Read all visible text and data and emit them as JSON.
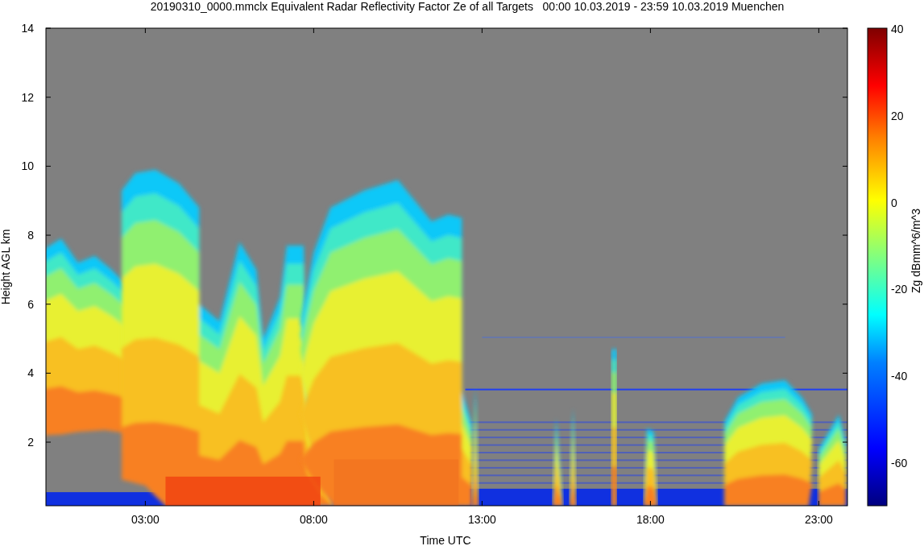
{
  "title": "20190310_0000.mmclx Equivalent Radar Reflectivity Factor Ze of all Targets   00:00 10.03.2019 - 23:59 10.03.2019 Muenchen",
  "y_axis": {
    "label": "Height AGL km",
    "ticks": [
      "14",
      "12",
      "10",
      "8",
      "6",
      "4",
      "2"
    ]
  },
  "x_axis": {
    "label": "Time UTC",
    "ticks": [
      "03:00",
      "08:00",
      "13:00",
      "18:00",
      "23:00"
    ]
  },
  "colorbar": {
    "label": "Zg dBmm^6/m^3",
    "ticks": [
      "40",
      "20",
      "0",
      "-20",
      "-40",
      "-60"
    ]
  }
}
